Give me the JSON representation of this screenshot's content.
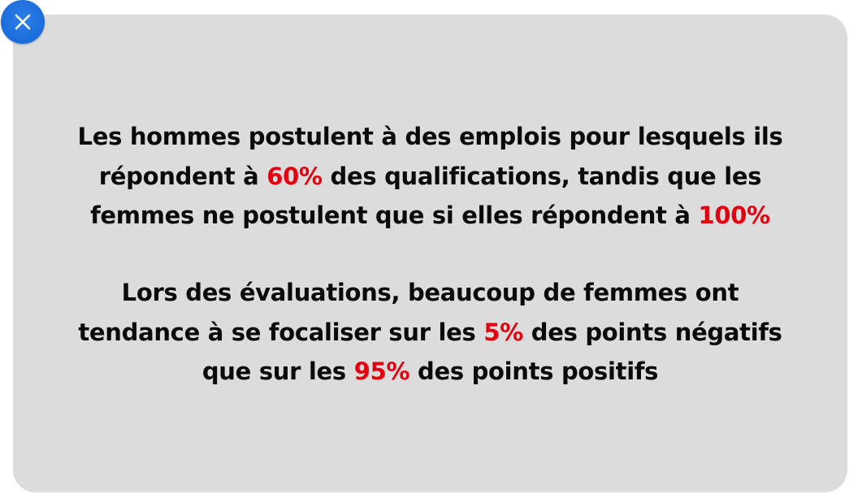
{
  "close_button": {
    "icon": "close-icon",
    "color": "#1a6fe0"
  },
  "card": {
    "background": "#dcdcdc",
    "highlight_color": "#e3000f",
    "paragraphs": [
      {
        "lines": [
          {
            "segments": [
              {
                "text": "Les hommes postulent à des emplois pour lesquels ils",
                "highlight": false
              }
            ]
          },
          {
            "segments": [
              {
                "text": "répondent à ",
                "highlight": false
              },
              {
                "text": "60%",
                "highlight": true
              },
              {
                "text": " des qualifications, tandis que les",
                "highlight": false
              }
            ]
          },
          {
            "segments": [
              {
                "text": "femmes ne postulent que si elles répondent à ",
                "highlight": false
              },
              {
                "text": "100%",
                "highlight": true
              }
            ]
          }
        ]
      },
      {
        "lines": [
          {
            "segments": [
              {
                "text": "Lors des évaluations, beaucoup de femmes ont",
                "highlight": false
              }
            ]
          },
          {
            "segments": [
              {
                "text": "tendance à se focaliser sur les ",
                "highlight": false
              },
              {
                "text": "5%",
                "highlight": true
              },
              {
                "text": " des points négatifs",
                "highlight": false
              }
            ]
          },
          {
            "segments": [
              {
                "text": "que sur les ",
                "highlight": false
              },
              {
                "text": "95%",
                "highlight": true
              },
              {
                "text": " des points positifs",
                "highlight": false
              }
            ]
          }
        ]
      }
    ]
  }
}
